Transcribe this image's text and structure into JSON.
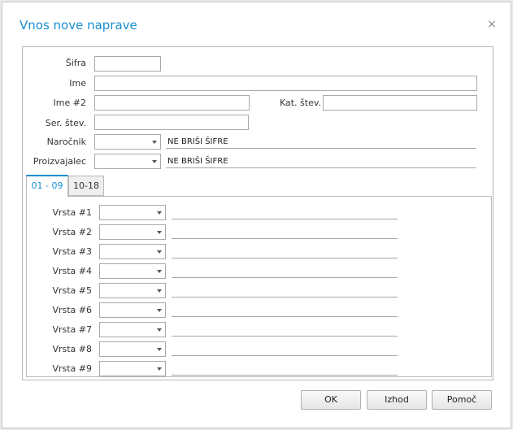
{
  "dialog": {
    "title": "Vnos nove naprave"
  },
  "icons": {
    "close": "×"
  },
  "fields": {
    "sifra_label": "Šifra",
    "sifra_value": "",
    "ime_label": "Ime",
    "ime_value": "",
    "ime2_label": "Ime #2",
    "ime2_value": "",
    "kat_label": "Kat. štev.",
    "kat_value": "",
    "ser_label": "Ser. štev.",
    "ser_value": "",
    "narocnik_label": "Naročnik",
    "narocnik_value": "",
    "narocnik_name": "NE BRIŠI ŠIFRE",
    "proizvajalec_label": "Proizvajalec",
    "proizvajalec_value": "",
    "proizvajalec_name": "NE BRIŠI ŠIFRE"
  },
  "tabs": [
    {
      "label": "01 - 09",
      "active": true
    },
    {
      "label": "10-18",
      "active": false
    }
  ],
  "vrsta": [
    {
      "label": "Vrsta #1",
      "value": "",
      "name": ""
    },
    {
      "label": "Vrsta #2",
      "value": "",
      "name": ""
    },
    {
      "label": "Vrsta #3",
      "value": "",
      "name": ""
    },
    {
      "label": "Vrsta #4",
      "value": "",
      "name": ""
    },
    {
      "label": "Vrsta #5",
      "value": "",
      "name": ""
    },
    {
      "label": "Vrsta #6",
      "value": "",
      "name": ""
    },
    {
      "label": "Vrsta #7",
      "value": "",
      "name": ""
    },
    {
      "label": "Vrsta #8",
      "value": "",
      "name": ""
    },
    {
      "label": "Vrsta #9",
      "value": "",
      "name": ""
    }
  ],
  "buttons": {
    "ok": "OK",
    "izhod": "Izhod",
    "pomoc": "Pomoč"
  },
  "colors": {
    "accent": "#1a8fd0"
  }
}
